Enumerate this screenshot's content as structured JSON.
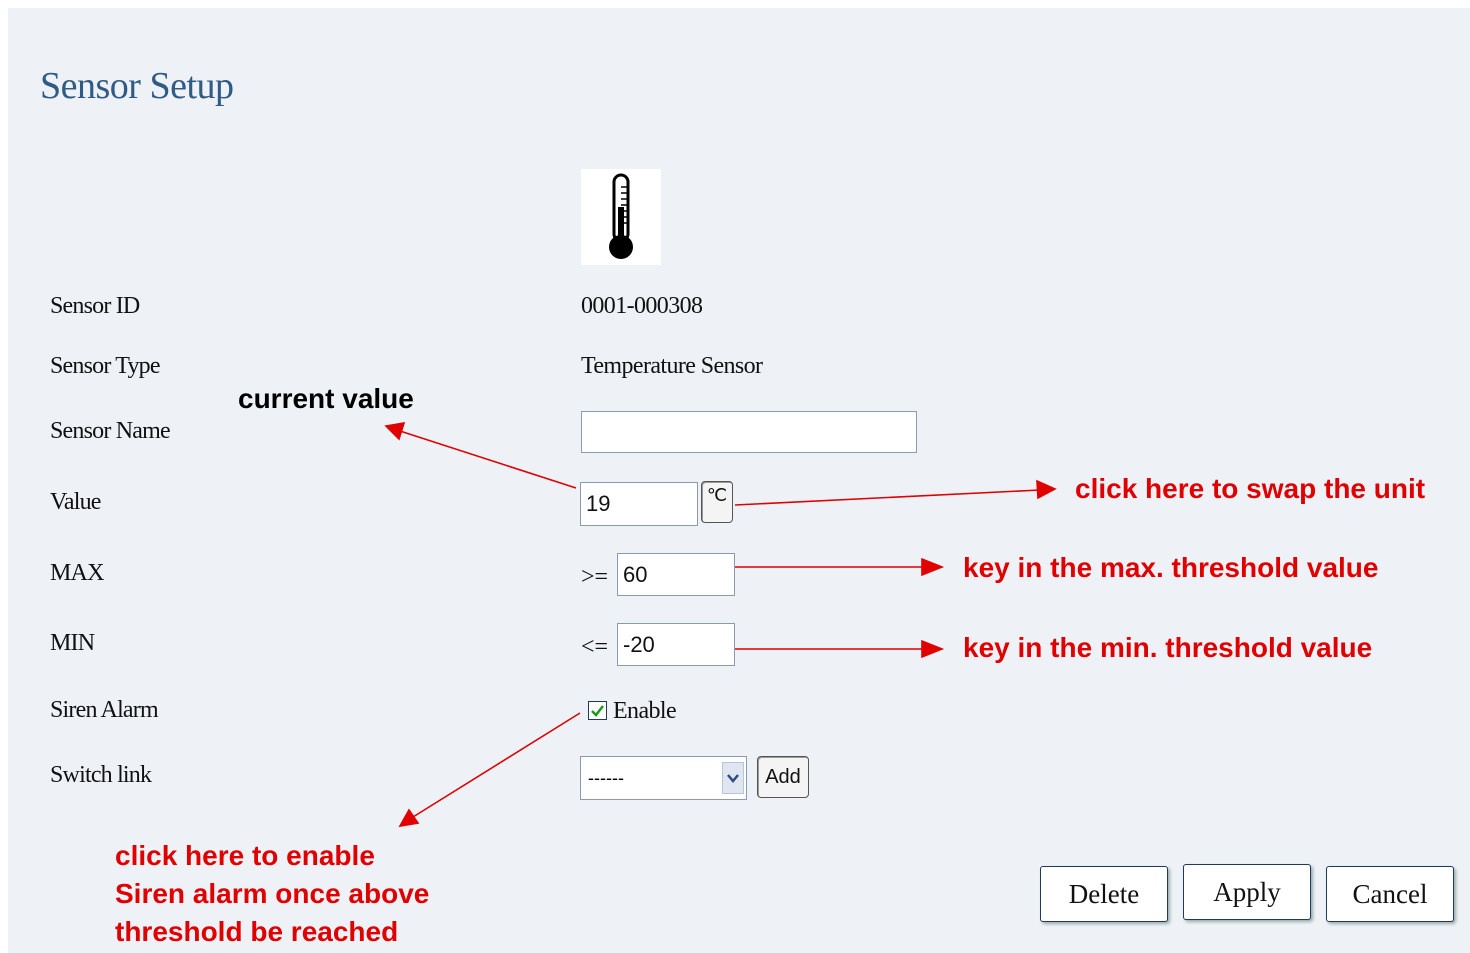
{
  "page": {
    "title": "Sensor Setup"
  },
  "fields": {
    "sensor_id": {
      "label": "Sensor ID",
      "value": "0001-000308"
    },
    "sensor_type": {
      "label": "Sensor Type",
      "value": "Temperature Sensor"
    },
    "sensor_name": {
      "label": "Sensor Name",
      "value": ""
    },
    "value": {
      "label": "Value",
      "value": "19",
      "unit_button": "℃"
    },
    "max": {
      "label": "MAX",
      "operator": ">=",
      "value": "60"
    },
    "min": {
      "label": "MIN",
      "operator": "<=",
      "value": "-20"
    },
    "siren_alarm": {
      "label": "Siren Alarm",
      "checkbox_label": "Enable",
      "checked": true
    },
    "switch_link": {
      "label": "Switch link",
      "selected": "------",
      "add_label": "Add"
    }
  },
  "buttons": {
    "delete": "Delete",
    "apply": "Apply",
    "cancel": "Cancel"
  },
  "annotations": {
    "current_value": "current value",
    "swap_unit": "click here to swap the unit",
    "max_threshold": "key in the max. threshold value",
    "min_threshold": "key in the min. threshold value",
    "siren_line1": "click here to enable",
    "siren_line2": "Siren alarm once above",
    "siren_line3": "threshold be reached"
  },
  "colors": {
    "annotation_red": "#e00000",
    "title_blue": "#2f5b84",
    "panel_bg": "#eef2f7"
  },
  "icons": {
    "sensor": "thermometer-icon",
    "dropdown": "chevron-down-icon",
    "check": "checkmark-icon"
  }
}
